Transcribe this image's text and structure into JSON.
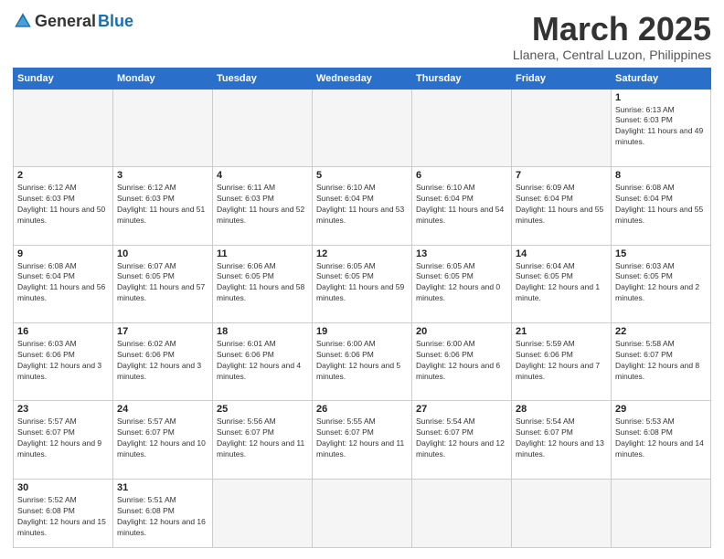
{
  "logo": {
    "text_general": "General",
    "text_blue": "Blue"
  },
  "header": {
    "title": "March 2025",
    "subtitle": "Llanera, Central Luzon, Philippines"
  },
  "weekdays": [
    "Sunday",
    "Monday",
    "Tuesday",
    "Wednesday",
    "Thursday",
    "Friday",
    "Saturday"
  ],
  "weeks": [
    [
      {
        "day": "",
        "empty": true
      },
      {
        "day": "",
        "empty": true
      },
      {
        "day": "",
        "empty": true
      },
      {
        "day": "",
        "empty": true
      },
      {
        "day": "",
        "empty": true
      },
      {
        "day": "",
        "empty": true
      },
      {
        "day": "1",
        "sunrise": "6:13 AM",
        "sunset": "6:03 PM",
        "daylight": "11 hours and 49 minutes."
      }
    ],
    [
      {
        "day": "2",
        "sunrise": "6:12 AM",
        "sunset": "6:03 PM",
        "daylight": "11 hours and 50 minutes."
      },
      {
        "day": "3",
        "sunrise": "6:12 AM",
        "sunset": "6:03 PM",
        "daylight": "11 hours and 51 minutes."
      },
      {
        "day": "4",
        "sunrise": "6:11 AM",
        "sunset": "6:03 PM",
        "daylight": "11 hours and 52 minutes."
      },
      {
        "day": "5",
        "sunrise": "6:10 AM",
        "sunset": "6:04 PM",
        "daylight": "11 hours and 53 minutes."
      },
      {
        "day": "6",
        "sunrise": "6:10 AM",
        "sunset": "6:04 PM",
        "daylight": "11 hours and 54 minutes."
      },
      {
        "day": "7",
        "sunrise": "6:09 AM",
        "sunset": "6:04 PM",
        "daylight": "11 hours and 55 minutes."
      },
      {
        "day": "8",
        "sunrise": "6:08 AM",
        "sunset": "6:04 PM",
        "daylight": "11 hours and 55 minutes."
      }
    ],
    [
      {
        "day": "9",
        "sunrise": "6:08 AM",
        "sunset": "6:04 PM",
        "daylight": "11 hours and 56 minutes."
      },
      {
        "day": "10",
        "sunrise": "6:07 AM",
        "sunset": "6:05 PM",
        "daylight": "11 hours and 57 minutes."
      },
      {
        "day": "11",
        "sunrise": "6:06 AM",
        "sunset": "6:05 PM",
        "daylight": "11 hours and 58 minutes."
      },
      {
        "day": "12",
        "sunrise": "6:05 AM",
        "sunset": "6:05 PM",
        "daylight": "11 hours and 59 minutes."
      },
      {
        "day": "13",
        "sunrise": "6:05 AM",
        "sunset": "6:05 PM",
        "daylight": "12 hours and 0 minutes."
      },
      {
        "day": "14",
        "sunrise": "6:04 AM",
        "sunset": "6:05 PM",
        "daylight": "12 hours and 1 minute."
      },
      {
        "day": "15",
        "sunrise": "6:03 AM",
        "sunset": "6:05 PM",
        "daylight": "12 hours and 2 minutes."
      }
    ],
    [
      {
        "day": "16",
        "sunrise": "6:03 AM",
        "sunset": "6:06 PM",
        "daylight": "12 hours and 3 minutes."
      },
      {
        "day": "17",
        "sunrise": "6:02 AM",
        "sunset": "6:06 PM",
        "daylight": "12 hours and 3 minutes."
      },
      {
        "day": "18",
        "sunrise": "6:01 AM",
        "sunset": "6:06 PM",
        "daylight": "12 hours and 4 minutes."
      },
      {
        "day": "19",
        "sunrise": "6:00 AM",
        "sunset": "6:06 PM",
        "daylight": "12 hours and 5 minutes."
      },
      {
        "day": "20",
        "sunrise": "6:00 AM",
        "sunset": "6:06 PM",
        "daylight": "12 hours and 6 minutes."
      },
      {
        "day": "21",
        "sunrise": "5:59 AM",
        "sunset": "6:06 PM",
        "daylight": "12 hours and 7 minutes."
      },
      {
        "day": "22",
        "sunrise": "5:58 AM",
        "sunset": "6:07 PM",
        "daylight": "12 hours and 8 minutes."
      }
    ],
    [
      {
        "day": "23",
        "sunrise": "5:57 AM",
        "sunset": "6:07 PM",
        "daylight": "12 hours and 9 minutes."
      },
      {
        "day": "24",
        "sunrise": "5:57 AM",
        "sunset": "6:07 PM",
        "daylight": "12 hours and 10 minutes."
      },
      {
        "day": "25",
        "sunrise": "5:56 AM",
        "sunset": "6:07 PM",
        "daylight": "12 hours and 11 minutes."
      },
      {
        "day": "26",
        "sunrise": "5:55 AM",
        "sunset": "6:07 PM",
        "daylight": "12 hours and 11 minutes."
      },
      {
        "day": "27",
        "sunrise": "5:54 AM",
        "sunset": "6:07 PM",
        "daylight": "12 hours and 12 minutes."
      },
      {
        "day": "28",
        "sunrise": "5:54 AM",
        "sunset": "6:07 PM",
        "daylight": "12 hours and 13 minutes."
      },
      {
        "day": "29",
        "sunrise": "5:53 AM",
        "sunset": "6:08 PM",
        "daylight": "12 hours and 14 minutes."
      }
    ],
    [
      {
        "day": "30",
        "sunrise": "5:52 AM",
        "sunset": "6:08 PM",
        "daylight": "12 hours and 15 minutes."
      },
      {
        "day": "31",
        "sunrise": "5:51 AM",
        "sunset": "6:08 PM",
        "daylight": "12 hours and 16 minutes."
      },
      {
        "day": "",
        "empty": true
      },
      {
        "day": "",
        "empty": true
      },
      {
        "day": "",
        "empty": true
      },
      {
        "day": "",
        "empty": true
      },
      {
        "day": "",
        "empty": true
      }
    ]
  ]
}
